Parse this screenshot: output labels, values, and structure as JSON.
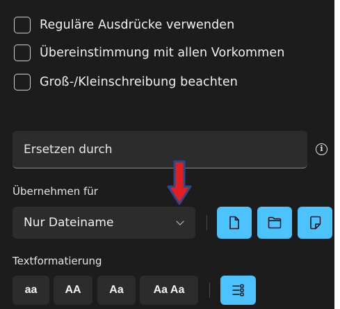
{
  "options": [
    {
      "label": "Reguläre Ausdrücke verwenden",
      "checked": false
    },
    {
      "label": "Übereinstimmung mit allen Vorkommen",
      "checked": false
    },
    {
      "label": "Groß-/Kleinschreibung beachten",
      "checked": false
    }
  ],
  "replace": {
    "placeholder": "Ersetzen durch",
    "info_icon": "info-icon"
  },
  "apply_to": {
    "label": "Übernehmen für",
    "selected": "Nur Dateiname",
    "icons": [
      "file-icon",
      "folder-icon",
      "file-and-folder-icon"
    ]
  },
  "text_format": {
    "label": "Textformatierung",
    "buttons": [
      "aa",
      "AA",
      "Aa",
      "Aa Aa"
    ],
    "list_icon": "enumerate-list-icon"
  },
  "colors": {
    "accent": "#4cc2ff",
    "background": "#1c1c1c",
    "control": "#2c2c2c",
    "annotation_arrow": "#e02020",
    "annotation_arrow_border": "#2b4a8a"
  }
}
